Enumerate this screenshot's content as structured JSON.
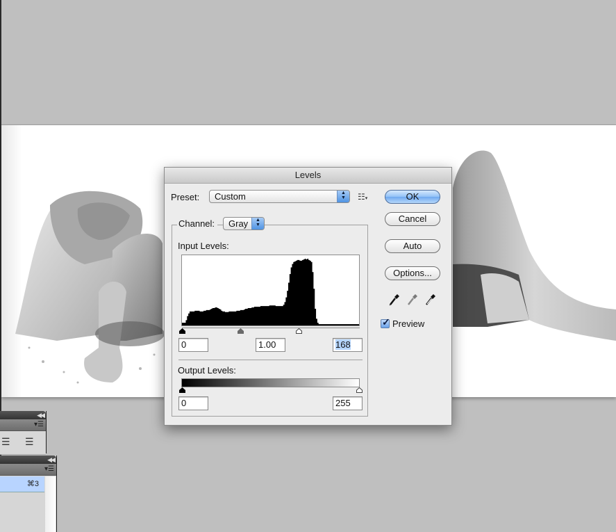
{
  "dialog": {
    "title": "Levels",
    "preset_label": "Preset:",
    "preset_value": "Custom",
    "preset_menu_icon": "list-options-icon",
    "channel_label": "Channel:",
    "channel_value": "Gray",
    "input_levels_label": "Input Levels:",
    "input_levels": {
      "black": "0",
      "gamma": "1.00",
      "white": "168"
    },
    "input_slider_positions": {
      "black": 0,
      "gamma": 84,
      "white": 168
    },
    "output_levels_label": "Output Levels:",
    "output_levels": {
      "black": "0",
      "white": "255"
    },
    "buttons": {
      "ok": "OK",
      "cancel": "Cancel",
      "auto": "Auto",
      "options": "Options..."
    },
    "eyedroppers": [
      "black-point-eyedropper-icon",
      "gray-point-eyedropper-icon",
      "white-point-eyedropper-icon"
    ],
    "preview_label": "Preview",
    "preview_checked": true
  },
  "histogram": {
    "channel": "Gray",
    "relative_counts": [
      4,
      4,
      4,
      8,
      14,
      18,
      21,
      21,
      21,
      21,
      22,
      22,
      22,
      22,
      21,
      21,
      21,
      22,
      22,
      23,
      23,
      23,
      24,
      25,
      26,
      26,
      27,
      27,
      26,
      25,
      24,
      22,
      21,
      21,
      20,
      20,
      20,
      21,
      21,
      21,
      21,
      21,
      21,
      22,
      22,
      22,
      23,
      23,
      23,
      24,
      25,
      25,
      26,
      26,
      26,
      27,
      27,
      28,
      28,
      28,
      28,
      28,
      29,
      29,
      29,
      29,
      29,
      29,
      29,
      30,
      30,
      30,
      30,
      30,
      29,
      29,
      29,
      29,
      29,
      29,
      31,
      35,
      42,
      52,
      64,
      77,
      87,
      92,
      95,
      96,
      97,
      98,
      98,
      97,
      97,
      98,
      99,
      100,
      99,
      100,
      98,
      97,
      95,
      80,
      55,
      25,
      10,
      4,
      2,
      2,
      2,
      2,
      2,
      2,
      2,
      2,
      2,
      2,
      2,
      2,
      2,
      2,
      2,
      2,
      2,
      2,
      2,
      2,
      2,
      2,
      2,
      2,
      2,
      2,
      2,
      2,
      2,
      2,
      2,
      2
    ],
    "range": [
      0,
      255
    ]
  },
  "panels": {
    "panel_1": {
      "menu_icon": "panel-menu-icon",
      "collapse_icon": "collapse-arrows-icon",
      "align_icons": [
        "align-left-icon",
        "justify-icon"
      ]
    },
    "panel_2": {
      "menu_icon": "panel-menu-icon",
      "collapse_icon": "collapse-arrows-icon",
      "selected_row_shortcut": "⌘3"
    }
  },
  "colors": {
    "workspace_bg": "#bfbfbf",
    "dialog_bg": "#ececec",
    "default_button_blue": "#92c2f6",
    "selection_highlight": "#b5d5fc",
    "panel_selected_row": "#b8d4ff"
  }
}
